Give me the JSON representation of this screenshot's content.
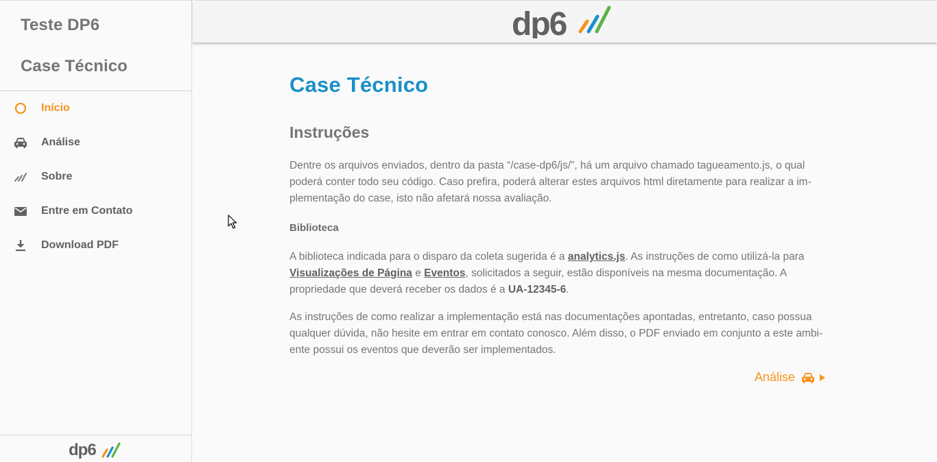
{
  "sidebar": {
    "title1": "Teste DP6",
    "title2": "Case Técnico",
    "items": [
      {
        "label": "Início",
        "icon": "circle-outline-icon",
        "active": true
      },
      {
        "label": "Análise",
        "icon": "car-icon",
        "active": false
      },
      {
        "label": "Sobre",
        "icon": "dp6-stripes-icon",
        "active": false
      },
      {
        "label": "Entre em Contato",
        "icon": "mail-icon",
        "active": false
      },
      {
        "label": "Download PDF",
        "icon": "download-icon",
        "active": false
      }
    ],
    "footer_logo": "dp6"
  },
  "header": {
    "logo": "dp6"
  },
  "main": {
    "title": "Case Técnico",
    "section_title": "Instruções",
    "para1": "Dentre os arquivos enviados, dentro da pasta “/case-dp6/js/”, há um arquivo chamado tagueamento.js, o qual poderá conter todo seu código. Caso prefira, poderá alterar estes arquivos html diretamente para realizar a im-plementação do case, isto não afetará nossa avaliação.",
    "library_title": "Biblioteca",
    "para2": {
      "t1": "A biblioteca indicada para o disparo da coleta sugerida é a ",
      "link1": "analytics.js",
      "t2": ". As instruções de como utilizá-la para ",
      "link2": "Visualizações de Página",
      "t3": " e ",
      "link3": "Eventos",
      "t4": ", solicitados a seguir, estão disponíveis na mesma documentação. A propriedade que deverá receber os dados é a ",
      "property": "UA-12345-6",
      "t5": "."
    },
    "para3": "As instruções de como realizar a implementação está nas documentações apontadas, entretanto, caso possua qualquer dúvida, não hesite em entrar em contato conosco. Além disso, o PDF enviado em conjunto a este ambi-ente possui os eventos que deverão ser implementados.",
    "next_link": "Análise"
  },
  "colors": {
    "accent": "#f7941d",
    "title_blue": "#1a8fc9",
    "text_gray": "#757575",
    "logo_gray": "#616161",
    "stripe_orange": "#f7941d",
    "stripe_blue": "#1a8fc9",
    "stripe_green": "#5bb446"
  }
}
